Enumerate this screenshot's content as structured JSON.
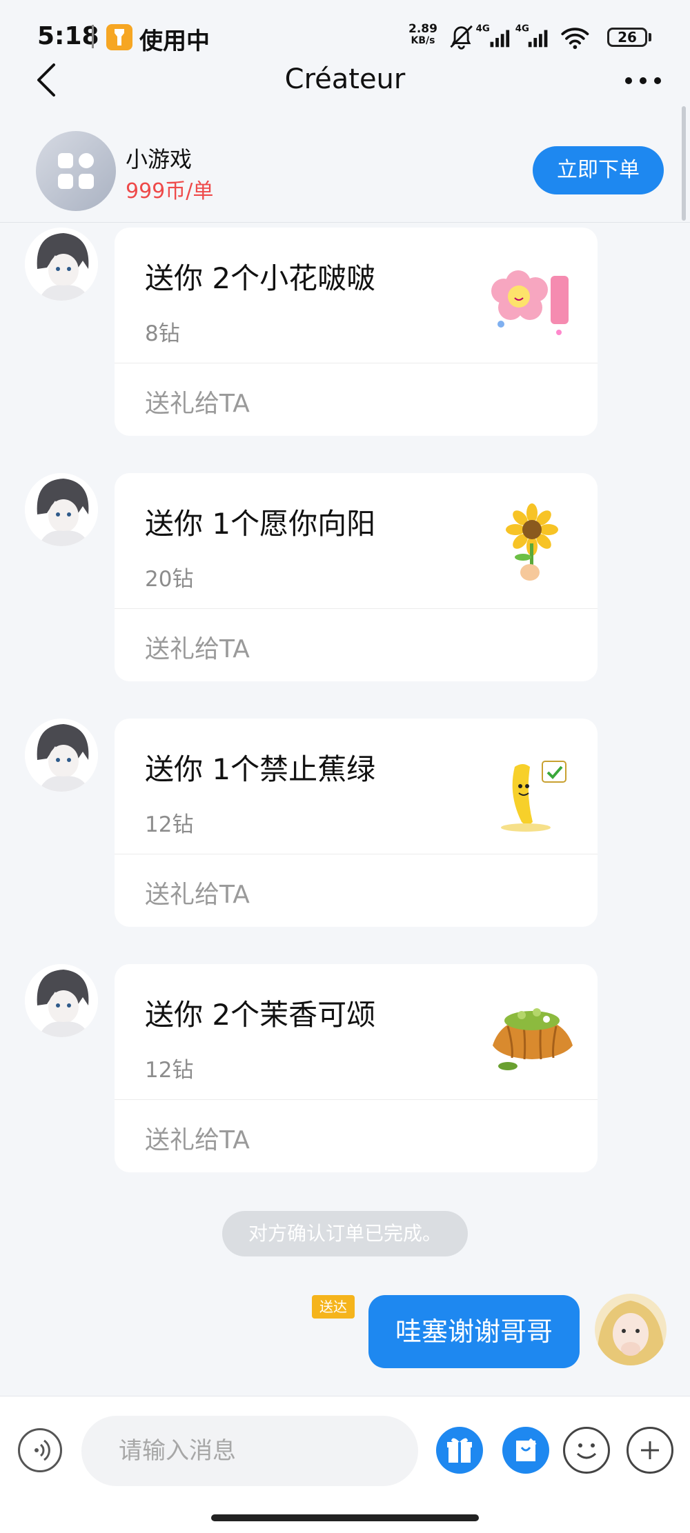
{
  "status_bar": {
    "time": "5:18",
    "app_in_use": "使用中",
    "net_speed_value": "2.89",
    "net_speed_unit": "KB/s",
    "signal_1": "4G",
    "signal_2": "4G",
    "battery": "26"
  },
  "nav": {
    "title": "Créateur"
  },
  "order_header": {
    "game_name": "小游戏",
    "price": "999币/单",
    "order_button": "立即下单"
  },
  "messages": [
    {
      "title": "送你 2个小花啵啵",
      "price": "8钻",
      "action": "送礼给TA",
      "icon": "pink-flower-gift-icon"
    },
    {
      "title": "送你 1个愿你向阳",
      "price": "20钻",
      "action": "送礼给TA",
      "icon": "sunflower-gift-icon"
    },
    {
      "title": "送你 1个禁止蕉绿",
      "price": "12钻",
      "action": "送礼给TA",
      "icon": "banana-gift-icon"
    },
    {
      "title": "送你 2个茉香可颂",
      "price": "12钻",
      "action": "送礼给TA",
      "icon": "croissant-gift-icon"
    }
  ],
  "system_note": "对方确认订单已完成。",
  "my_message": {
    "tag": "送达",
    "text": "哇塞谢谢哥哥"
  },
  "input_bar": {
    "placeholder": "请输入消息"
  },
  "colors": {
    "accent": "#1e88f0",
    "price_red": "#ee4a4a",
    "sent_tag": "#f5b41c",
    "background": "#f4f6f9"
  }
}
